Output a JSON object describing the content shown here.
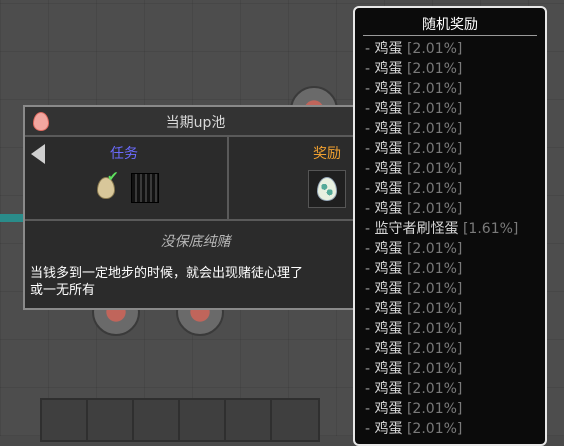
{
  "quest": {
    "title": "当期up池",
    "task_label": "任务",
    "reward_label": "奖励",
    "subtitle": "没保底纯赌",
    "description": "当钱多到一定地步的时候，就会出现赌徒心理了\n或一无所有",
    "colors": {
      "task_label": "#6b6bff",
      "reward_label": "#f0a030"
    }
  },
  "tooltip": {
    "title": "随机奖励",
    "items": [
      {
        "dash": "-",
        "name": "鸡蛋",
        "pct": "[2.01%]"
      },
      {
        "dash": "-",
        "name": "鸡蛋",
        "pct": "[2.01%]"
      },
      {
        "dash": "-",
        "name": "鸡蛋",
        "pct": "[2.01%]"
      },
      {
        "dash": "-",
        "name": "鸡蛋",
        "pct": "[2.01%]"
      },
      {
        "dash": "-",
        "name": "鸡蛋",
        "pct": "[2.01%]"
      },
      {
        "dash": "-",
        "name": "鸡蛋",
        "pct": "[2.01%]"
      },
      {
        "dash": "-",
        "name": "鸡蛋",
        "pct": "[2.01%]"
      },
      {
        "dash": "-",
        "name": "鸡蛋",
        "pct": "[2.01%]"
      },
      {
        "dash": "-",
        "name": "鸡蛋",
        "pct": "[2.01%]"
      },
      {
        "dash": "-",
        "name": "监守者刷怪蛋",
        "pct": "[1.61%]"
      },
      {
        "dash": "-",
        "name": "鸡蛋",
        "pct": "[2.01%]"
      },
      {
        "dash": "-",
        "name": "鸡蛋",
        "pct": "[2.01%]"
      },
      {
        "dash": "-",
        "name": "鸡蛋",
        "pct": "[2.01%]"
      },
      {
        "dash": "-",
        "name": "鸡蛋",
        "pct": "[2.01%]"
      },
      {
        "dash": "-",
        "name": "鸡蛋",
        "pct": "[2.01%]"
      },
      {
        "dash": "-",
        "name": "鸡蛋",
        "pct": "[2.01%]"
      },
      {
        "dash": "-",
        "name": "鸡蛋",
        "pct": "[2.01%]"
      },
      {
        "dash": "-",
        "name": "鸡蛋",
        "pct": "[2.01%]"
      },
      {
        "dash": "-",
        "name": "鸡蛋",
        "pct": "[2.01%]"
      },
      {
        "dash": "-",
        "name": "鸡蛋",
        "pct": "[2.01%]"
      }
    ]
  },
  "icons": {
    "header": "pink-egg-icon",
    "back": "back-arrow-icon",
    "task_item": "egg-icon",
    "task_done": "checkmark-icon",
    "task_block": "dark-block-icon",
    "reward_item": "spawn-egg-icon"
  }
}
